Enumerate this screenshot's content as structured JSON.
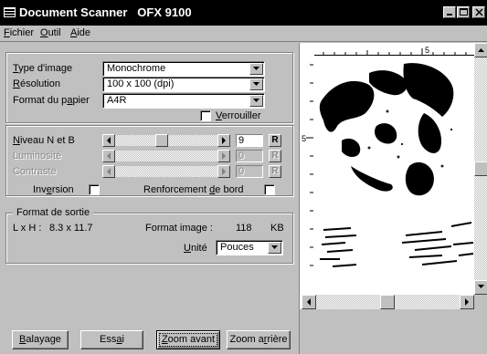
{
  "window": {
    "title": "Document Scanner   OFX 9100",
    "icon": "scanner-app-icon",
    "controls": [
      "minimize-icon",
      "maximize-icon",
      "close-icon"
    ]
  },
  "menu": {
    "items": [
      {
        "label": "Fichier",
        "mnemonic": "F"
      },
      {
        "label": "Outil",
        "mnemonic": "O"
      },
      {
        "label": "Aide",
        "mnemonic": "A"
      }
    ]
  },
  "settings": {
    "image_type": {
      "label": "Type d'image",
      "value": "Monochrome"
    },
    "resolution": {
      "label": "Résolution",
      "value": "100 x 100 (dpi)"
    },
    "paper_format": {
      "label": "Format du papier",
      "value": "A4R"
    },
    "lock": {
      "label": "Verrouiller",
      "checked": false
    }
  },
  "adjust": {
    "bw_level": {
      "label": "Niveau N et B",
      "value": "9",
      "position": 0.45,
      "enabled": true
    },
    "brightness": {
      "label": "Luminosité",
      "value": "0",
      "enabled": false
    },
    "contrast": {
      "label": "Contraste",
      "value": "0",
      "enabled": false
    },
    "reset_label": "R",
    "inversion": {
      "label": "Inversion",
      "checked": false
    },
    "edge_enhance": {
      "label": "Renforcement de bord",
      "checked": false
    }
  },
  "output": {
    "group_title": "Format de sortie",
    "size_label": "L x H :",
    "size_value": "8.3 x 11.7",
    "image_size_label": "Format image :",
    "image_size_value": "118",
    "image_size_unit": "KB",
    "unit_label": "Unité",
    "unit_value": "Pouces"
  },
  "buttons": {
    "scan": "Balayage",
    "test": "Essai",
    "zoom_in": "Zoom avant",
    "zoom_out": "Zoom arrière"
  },
  "preview": {
    "ruler_h_mark": "5",
    "ruler_v_mark": "5",
    "image": "scanned-dog-photo"
  }
}
